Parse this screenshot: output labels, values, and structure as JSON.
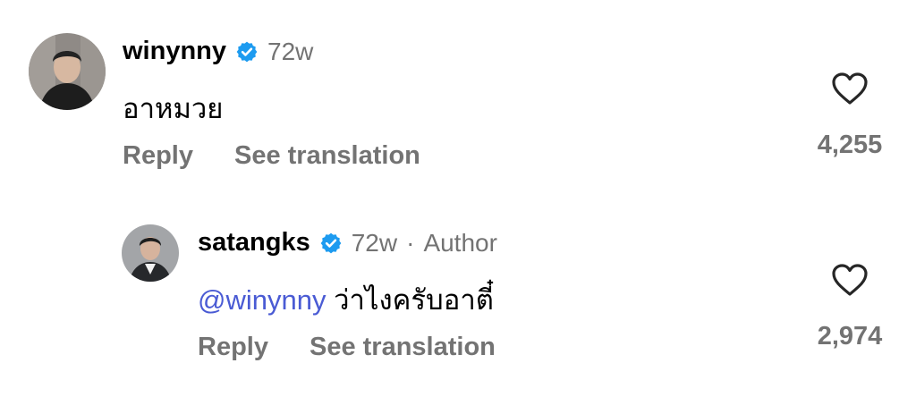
{
  "comments": [
    {
      "username": "winynny",
      "verified": true,
      "time": "72w",
      "text": "อาหมวย",
      "actions": {
        "reply": "Reply",
        "translate": "See translation"
      },
      "likes": "4,255",
      "avatar": "avatar-photo"
    },
    {
      "username": "satangks",
      "verified": true,
      "time": "72w",
      "separator": "·",
      "role": "Author",
      "mention": "@winynny",
      "text": "ว่าไงครับอาตี๋",
      "actions": {
        "reply": "Reply",
        "translate": "See translation"
      },
      "likes": "2,974",
      "avatar": "avatar-photo"
    }
  ],
  "colors": {
    "verified_badge": "#1d9bf0",
    "mention": "#4a5bd4",
    "secondary_text": "#737373"
  }
}
